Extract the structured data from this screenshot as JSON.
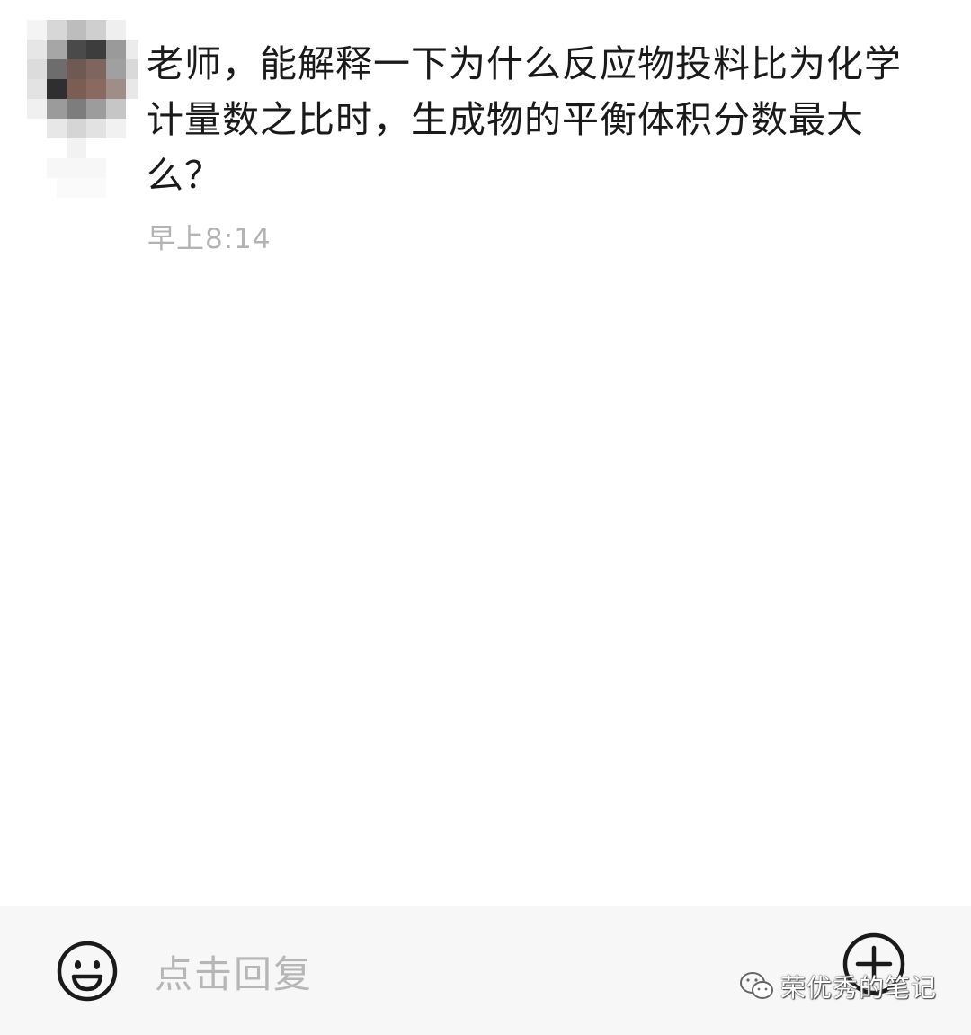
{
  "chat": {
    "message": "老师，能解释一下为什么反应物投料比为化学计量数之比时，生成物的平衡体积分数最大么？",
    "timestamp": "早上8:14",
    "sender_avatar": "pixelated-avatar"
  },
  "reply_bar": {
    "placeholder": "点击回复",
    "left_icon": "emoji-smile-icon",
    "right_icon": "plus-circle-icon"
  },
  "watermark": {
    "icon": "wechat-icon",
    "text": "荣优秀的笔记"
  },
  "colors": {
    "message_text": "#1a1a1a",
    "timestamp": "#b3b3b3",
    "reply_bar_bg": "#f7f7f7",
    "placeholder": "#b6b6b6",
    "icon_stroke": "#1a1a1a"
  }
}
